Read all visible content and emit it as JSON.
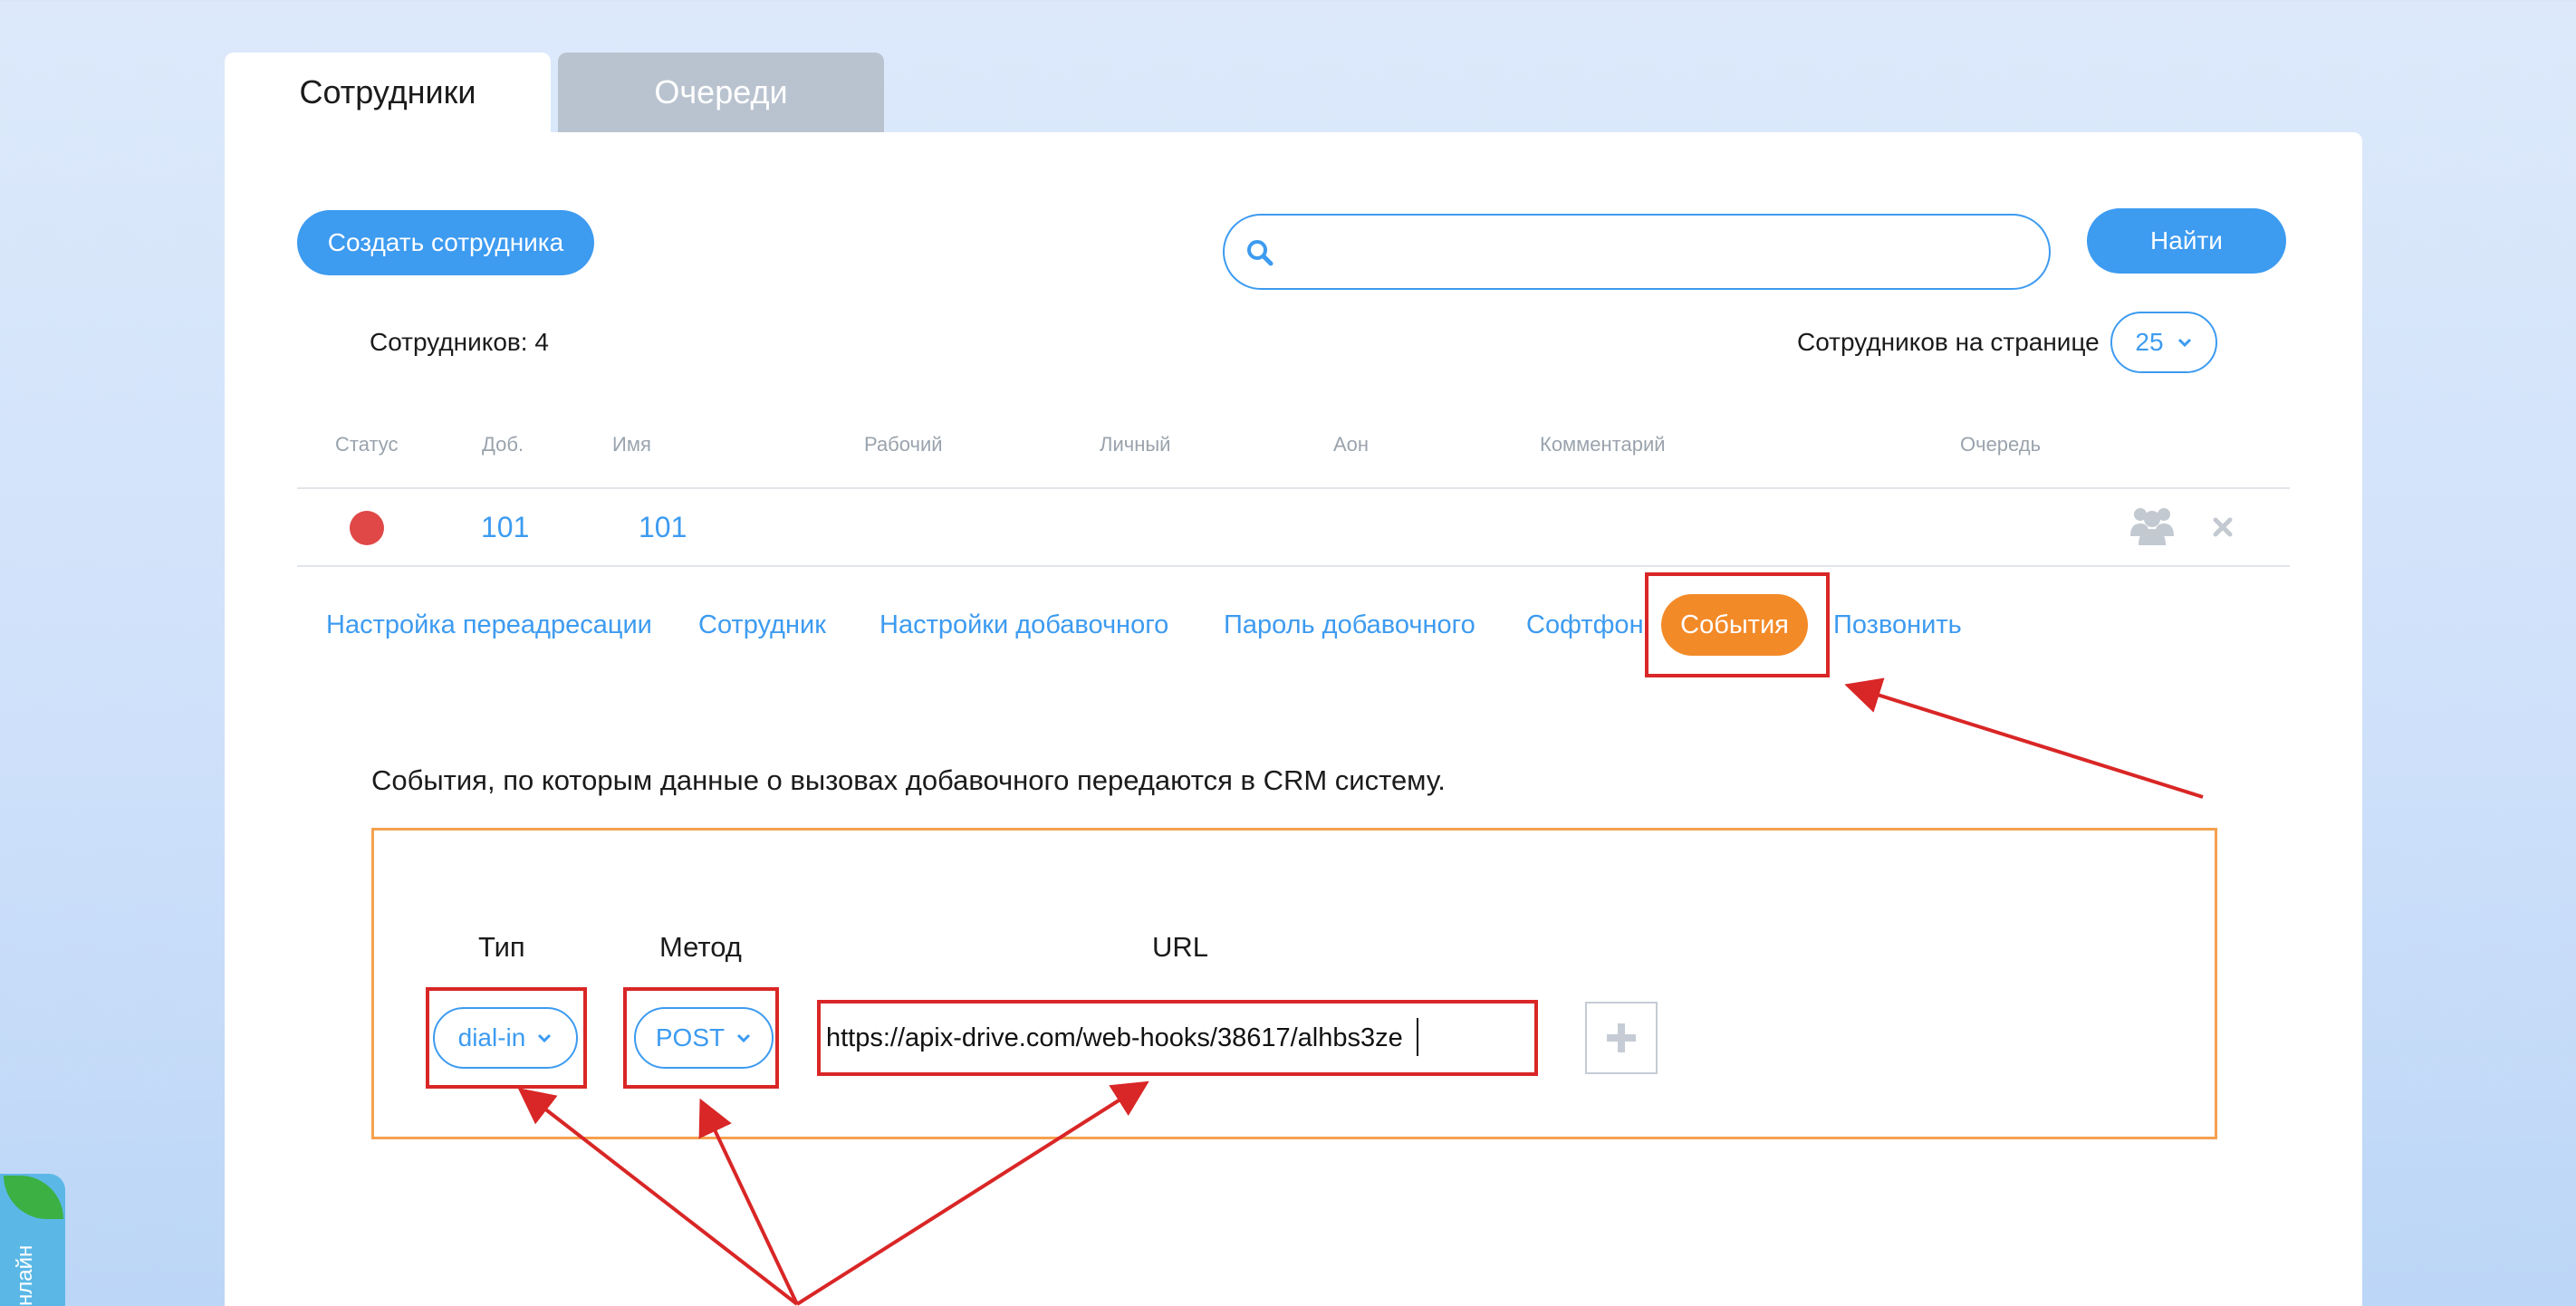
{
  "tabs": [
    {
      "label": "Сотрудники",
      "active": true
    },
    {
      "label": "Очереди",
      "active": false
    }
  ],
  "toolbar": {
    "create_label": "Создать сотрудника",
    "search_value": "",
    "search_placeholder": "",
    "find_label": "Найти"
  },
  "summary": {
    "count_label": "Сотрудников: 4",
    "per_page_label": "Сотрудников на странице",
    "per_page_value": "25"
  },
  "table": {
    "headers": [
      "Статус",
      "Доб.",
      "Имя",
      "Рабочий",
      "Личный",
      "Аон",
      "Комментарий",
      "Очередь"
    ],
    "rows": [
      {
        "status_color": "#e04747",
        "ext": "101",
        "name": "101",
        "work": "",
        "personal": "",
        "aon": "",
        "comment": "",
        "queue": ""
      }
    ]
  },
  "subnav": {
    "items": [
      {
        "label": "Настройка переадресации"
      },
      {
        "label": "Сотрудник"
      },
      {
        "label": "Настройки добавочного"
      },
      {
        "label": "Пароль добавочного"
      },
      {
        "label": "Софтфон"
      },
      {
        "label": "События",
        "active": true
      },
      {
        "label": "Позвонить"
      }
    ]
  },
  "events": {
    "description": "События, по которым данные о вызовах добавочного передаются в CRM систему.",
    "type_header": "Тип",
    "method_header": "Метод",
    "url_header": "URL",
    "type_value": "dial-in",
    "method_value": "POST",
    "url_value": "https://apix-drive.com/web-hooks/38617/alhbs3ze"
  },
  "side_widget": {
    "label": "нлайн"
  },
  "colors": {
    "accent": "#3d9bf0",
    "active_tab_pill": "#f38a28",
    "highlight": "#d92626",
    "frame": "#f5a04f"
  }
}
